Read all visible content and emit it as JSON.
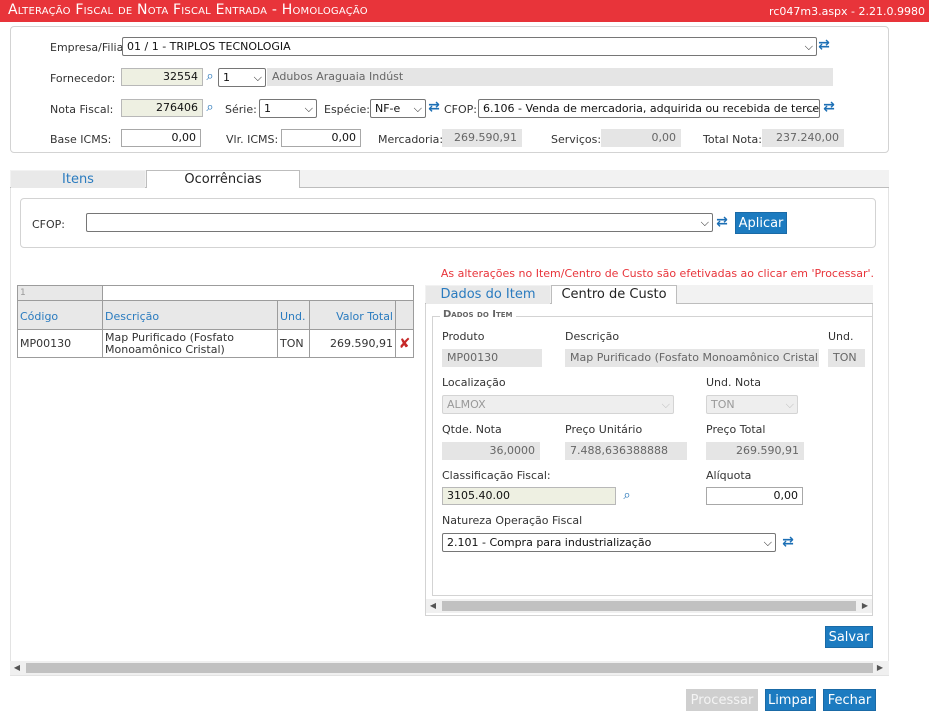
{
  "window": {
    "title": "Alteração Fiscal de Nota Fiscal Entrada  - Homologação",
    "version": "rc047m3.aspx - 2.21.0.9980"
  },
  "header": {
    "empresa_label": "Empresa/Filial",
    "empresa_value": "01 / 1 - TRIPLOS TECNOLOGIA",
    "fornecedor_label": "Fornecedor:",
    "fornecedor_code": "32554",
    "fornecedor_branch": "1",
    "fornecedor_name": "Adubos Araguaia Indúst",
    "nota_label": "Nota Fiscal:",
    "nota_value": "276406",
    "serie_label": "Série:",
    "serie_value": "1",
    "especie_label": "Espécie:",
    "especie_value": "NF-e",
    "cfop_label": "CFOP:",
    "cfop_value": "6.106 - Venda de mercadoria, adquirida ou recebida de terce",
    "base_icms_label": "Base ICMS:",
    "base_icms_value": "0,00",
    "vlr_icms_label": "Vlr. ICMS:",
    "vlr_icms_value": "0,00",
    "mercadoria_label": "Mercadoria:",
    "mercadoria_value": "269.590,91",
    "servicos_label": "Serviços:",
    "servicos_value": "0,00",
    "total_label": "Total Nota:",
    "total_value": "237.240,00"
  },
  "tabs": {
    "itens": "Itens",
    "ocorrencias": "Ocorrências"
  },
  "cfop_filter": {
    "label": "CFOP:",
    "value": "",
    "apply": "Aplicar"
  },
  "notice": "As alterações no Item/Centro de Custo são efetivadas ao clicar em 'Processar'.",
  "items_table": {
    "page": "1",
    "columns": [
      "Código",
      "Descrição",
      "Und.",
      "Valor Total"
    ],
    "rows": [
      {
        "codigo": "MP00130",
        "descricao": "Map Purificado (Fosfato Monoamônico Cristal)",
        "und": "TON",
        "valor": "269.590,91"
      }
    ]
  },
  "item_tabs": {
    "dados": "Dados do Item",
    "centro": "Centro de Custo"
  },
  "dados_item": {
    "section": "Dados do Item",
    "produto_label": "Produto",
    "produto_value": "MP00130",
    "descricao_label": "Descrição",
    "descricao_value": "Map Purificado (Fosfato Monoamônico Cristal)",
    "und_label": "Und.",
    "und_value": "TON",
    "localizacao_label": "Localização",
    "localizacao_value": "ALMOX",
    "und_nota_label": "Und. Nota",
    "und_nota_value": "TON",
    "qtde_label": "Qtde. Nota",
    "qtde_value": "36,0000",
    "preco_unit_label": "Preço Unitário",
    "preco_unit_value": "7.488,636388888",
    "preco_total_label": "Preço Total",
    "preco_total_value": "269.590,91",
    "classificacao_label": "Classificação Fiscal:",
    "classificacao_value": "3105.40.00",
    "aliquota_label": "Alíquota",
    "aliquota_value": "0,00",
    "natureza_label": "Natureza Operação Fiscal",
    "natureza_value": "2.101 - Compra para industrialização"
  },
  "buttons": {
    "salvar": "Salvar",
    "processar": "Processar",
    "limpar": "Limpar",
    "fechar": "Fechar"
  },
  "colors": {
    "titlebar": "#e8343a",
    "primary": "#1c7bc0",
    "notice": "#e8343a"
  }
}
